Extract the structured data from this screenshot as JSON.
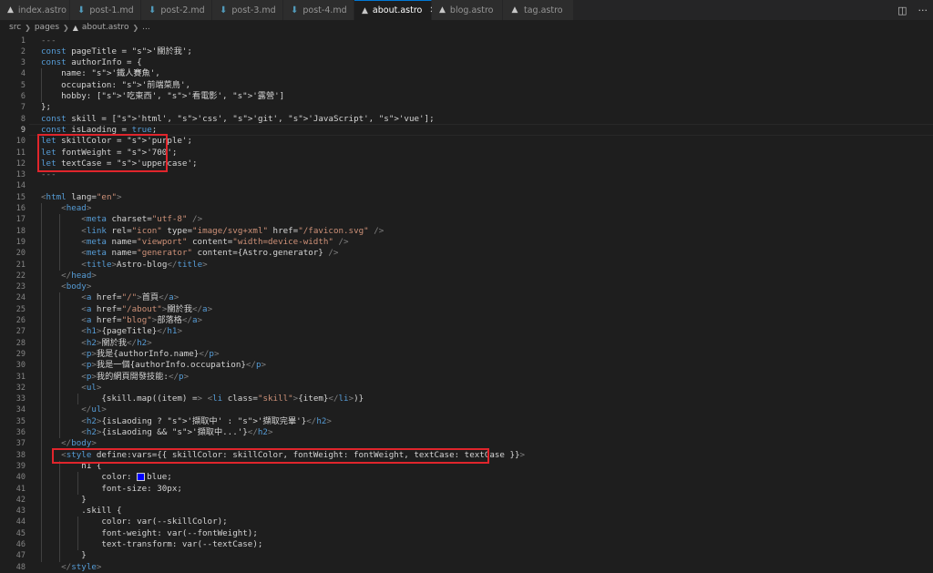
{
  "tabs": [
    {
      "label": "index.astro",
      "icon": "rocket-icon",
      "active": false
    },
    {
      "label": "post-1.md",
      "icon": "markdown-icon",
      "active": false
    },
    {
      "label": "post-2.md",
      "icon": "markdown-icon",
      "active": false
    },
    {
      "label": "post-3.md",
      "icon": "markdown-icon",
      "active": false
    },
    {
      "label": "post-4.md",
      "icon": "markdown-icon",
      "active": false
    },
    {
      "label": "about.astro",
      "icon": "rocket-icon",
      "active": true
    },
    {
      "label": "blog.astro",
      "icon": "rocket-icon",
      "active": false
    },
    {
      "label": "tag.astro",
      "icon": "rocket-icon",
      "active": false
    }
  ],
  "breadcrumb": {
    "root": "src",
    "folder": "pages",
    "file": "about.astro",
    "rest": "..."
  },
  "code_lines": [
    {
      "n": "1",
      "t": "---"
    },
    {
      "n": "2",
      "t": "const pageTitle = '關於我';"
    },
    {
      "n": "3",
      "t": "const authorInfo = {"
    },
    {
      "n": "4",
      "t": "    name: '鐵人賽魚',"
    },
    {
      "n": "5",
      "t": "    occupation: '前端菜鳥',"
    },
    {
      "n": "6",
      "t": "    hobby: ['吃東西', '看電影', '露營']"
    },
    {
      "n": "7",
      "t": "};"
    },
    {
      "n": "8",
      "t": "const skill = ['html', 'css', 'git', 'JavaScript', 'vue'];"
    },
    {
      "n": "9",
      "t": "const isLaoding = true;"
    },
    {
      "n": "10",
      "t": "let skillColor = 'purple';"
    },
    {
      "n": "11",
      "t": "let fontWeight = '700';"
    },
    {
      "n": "12",
      "t": "let textCase = 'uppercase';"
    },
    {
      "n": "13",
      "t": "---"
    },
    {
      "n": "14",
      "t": ""
    },
    {
      "n": "15",
      "t": "<html lang=\"en\">"
    },
    {
      "n": "16",
      "t": "    <head>"
    },
    {
      "n": "17",
      "t": "        <meta charset=\"utf-8\" />"
    },
    {
      "n": "18",
      "t": "        <link rel=\"icon\" type=\"image/svg+xml\" href=\"/favicon.svg\" />"
    },
    {
      "n": "19",
      "t": "        <meta name=\"viewport\" content=\"width=device-width\" />"
    },
    {
      "n": "20",
      "t": "        <meta name=\"generator\" content={Astro.generator} />"
    },
    {
      "n": "21",
      "t": "        <title>Astro-blog</title>"
    },
    {
      "n": "22",
      "t": "    </head>"
    },
    {
      "n": "23",
      "t": "    <body>"
    },
    {
      "n": "24",
      "t": "        <a href=\"/\">首頁</a>"
    },
    {
      "n": "25",
      "t": "        <a href=\"/about\">關於我</a>"
    },
    {
      "n": "26",
      "t": "        <a href=\"blog\">部落格</a>"
    },
    {
      "n": "27",
      "t": "        <h1>{pageTitle}</h1>"
    },
    {
      "n": "28",
      "t": "        <h2>關於我</h2>"
    },
    {
      "n": "29",
      "t": "        <p>我是{authorInfo.name}</p>"
    },
    {
      "n": "30",
      "t": "        <p>我是一個{authorInfo.occupation}</p>"
    },
    {
      "n": "31",
      "t": "        <p>我的網頁開發技能:</p>"
    },
    {
      "n": "32",
      "t": "        <ul>"
    },
    {
      "n": "33",
      "t": "            {skill.map((item) => <li class=\"skill\">{item}</li>)}"
    },
    {
      "n": "34",
      "t": "        </ul>"
    },
    {
      "n": "35",
      "t": "        <h2>{isLaoding ? '擷取中' : '擷取完畢'}</h2>"
    },
    {
      "n": "36",
      "t": "        <h2>{isLaoding && '擷取中...'}</h2>"
    },
    {
      "n": "37",
      "t": "    </body>"
    },
    {
      "n": "38",
      "t": "    <style define:vars={{ skillColor: skillColor, fontWeight: fontWeight, textCase: textCase }}>"
    },
    {
      "n": "39",
      "t": "        h1 {"
    },
    {
      "n": "40",
      "t": "            color: blue;"
    },
    {
      "n": "41",
      "t": "            font-size: 30px;"
    },
    {
      "n": "42",
      "t": "        }"
    },
    {
      "n": "43",
      "t": "        .skill {"
    },
    {
      "n": "44",
      "t": "            color: var(--skillColor);"
    },
    {
      "n": "45",
      "t": "            font-weight: var(--fontWeight);"
    },
    {
      "n": "46",
      "t": "            text-transform: var(--textCase);"
    },
    {
      "n": "47",
      "t": "        }"
    },
    {
      "n": "48",
      "t": "    </style>"
    }
  ],
  "colors": {
    "highlight_box": "#e0252c",
    "active_tab_border": "#0078d4",
    "editor_bg": "#1e1e1e"
  }
}
